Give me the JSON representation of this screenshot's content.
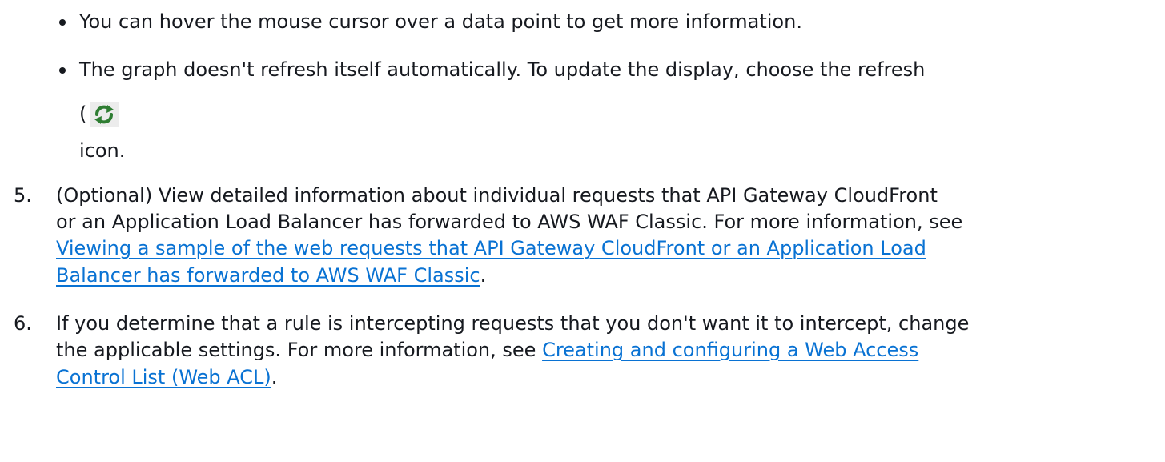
{
  "bullets": [
    {
      "text": "You can hover the mouse cursor over a data point to get more information."
    },
    {
      "line1": "The graph doesn't refresh itself automatically. To update the display, choose the refresh",
      "line2": "(",
      "line3": "icon."
    }
  ],
  "steps": [
    {
      "number": "5.",
      "line1": "(Optional) View detailed information about individual requests that API Gateway CloudFront",
      "line2": "or an Application Load Balancer has forwarded to AWS WAF Classic. For more information, see",
      "link_line1": "Viewing a sample of the web requests that API Gateway CloudFront or an Application Load",
      "link_line2": "Balancer has forwarded to AWS WAF Classic",
      "after_link": "."
    },
    {
      "number": "6.",
      "line1": "If you determine that a rule is intercepting requests that you don't want it to intercept, change",
      "line2_before_link": "the applicable settings. For more information, see ",
      "link_line1": "Creating and configuring a Web Access",
      "link_line2": "Control List (Web ACL)",
      "after_link": "."
    }
  ],
  "icons": {
    "refresh": "refresh-icon"
  },
  "colors": {
    "text": "#16191f",
    "link": "#0972d3",
    "icon": "#2e7d32"
  }
}
